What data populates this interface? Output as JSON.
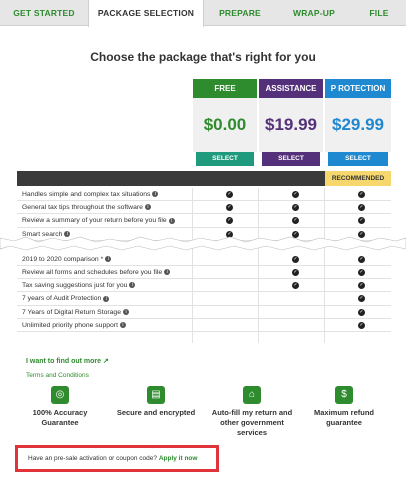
{
  "tabs": [
    {
      "label": "GET STARTED"
    },
    {
      "label": "PACKAGE SELECTION"
    },
    {
      "label": "PREPARE"
    },
    {
      "label": "WRAP-UP"
    },
    {
      "label": "FILE"
    }
  ],
  "heading": "Choose the package that's right for you",
  "packages": [
    {
      "name": "FREE",
      "price": "$0.00",
      "button": "SELECT",
      "color": "#2e8b2e",
      "price_color": "#2e8b2e",
      "button_color": "#1f9a7d"
    },
    {
      "name": "ASSISTANCE",
      "price": "$19.99",
      "button": "SELECT",
      "color": "#55307a",
      "price_color": "#55307a",
      "button_color": "#55307a"
    },
    {
      "name": "P ROTECTION",
      "price": "$29.99",
      "button": "SELECT",
      "color": "#1e88d0",
      "price_color": "#1e88d0",
      "button_color": "#1e88d0"
    }
  ],
  "recommended_label": "RECOMMENDED",
  "features": [
    {
      "label": "Handles simple and complex tax situations",
      "checks": [
        true,
        true,
        true
      ]
    },
    {
      "label": "General tax tips throughout the software",
      "checks": [
        true,
        true,
        true
      ]
    },
    {
      "label": "Review a summary of your return before you file",
      "checks": [
        true,
        true,
        true
      ]
    },
    {
      "label": "Smart search",
      "checks": [
        true,
        true,
        true
      ]
    },
    {
      "label": "2019 to 2020 comparison *",
      "checks": [
        false,
        true,
        true
      ]
    },
    {
      "label": "Review all forms and schedules before you file",
      "checks": [
        false,
        true,
        true
      ]
    },
    {
      "label": "Tax saving suggestions just for you",
      "checks": [
        false,
        true,
        true
      ]
    },
    {
      "label": "7 years of Audit Protection",
      "checks": [
        false,
        false,
        true
      ]
    },
    {
      "label": "7 Years of Digital Return Storage",
      "checks": [
        false,
        false,
        true
      ]
    },
    {
      "label": "Unlimited priority phone support",
      "checks": [
        false,
        false,
        true
      ]
    }
  ],
  "links": {
    "find_out_more": "I want to find out more",
    "terms": "Terms and Conditions"
  },
  "guarantees": [
    {
      "text": "100% Accuracy Guarantee",
      "icon": "target-icon"
    },
    {
      "text": "Secure and encrypted",
      "icon": "lock-icon"
    },
    {
      "text": "Auto-fill my return and other government services",
      "icon": "government-building-icon"
    },
    {
      "text": "Maximum refund guarantee",
      "icon": "refund-icon"
    }
  ],
  "coupon": {
    "text": "Have an pre-sale activation or coupon code?",
    "link": "Apply it now"
  }
}
